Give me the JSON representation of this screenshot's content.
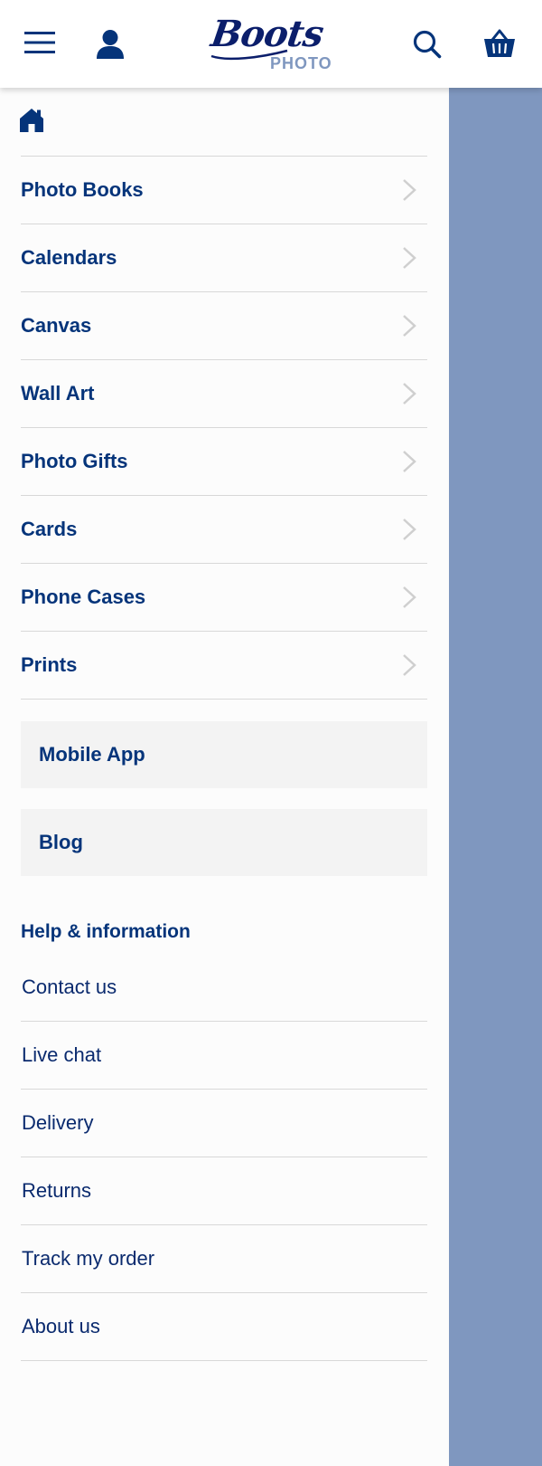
{
  "header": {
    "logo_script": "Boots",
    "logo_sub": "PHOTO"
  },
  "icons": {
    "menu": "hamburger-menu-icon",
    "account": "user-icon",
    "search": "search-icon",
    "basket": "basket-icon",
    "home": "home-icon",
    "chevron": "chevron-right-icon"
  },
  "colors": {
    "brand_navy": "#05347a",
    "overlay": "#7f97bf",
    "promo_bg": "#f3f3f3",
    "divider": "#d8d8d8"
  },
  "nav": {
    "items": [
      {
        "label": "Photo Books"
      },
      {
        "label": "Calendars"
      },
      {
        "label": "Canvas"
      },
      {
        "label": "Wall Art"
      },
      {
        "label": "Photo Gifts"
      },
      {
        "label": "Cards"
      },
      {
        "label": "Phone Cases"
      },
      {
        "label": "Prints"
      }
    ]
  },
  "promos": {
    "mobile_app": "Mobile App",
    "blog": "Blog"
  },
  "help": {
    "title": "Help & information",
    "items": [
      {
        "label": "Contact us"
      },
      {
        "label": "Live chat"
      },
      {
        "label": "Delivery"
      },
      {
        "label": "Returns"
      },
      {
        "label": "Track my order"
      },
      {
        "label": "About us"
      }
    ]
  }
}
